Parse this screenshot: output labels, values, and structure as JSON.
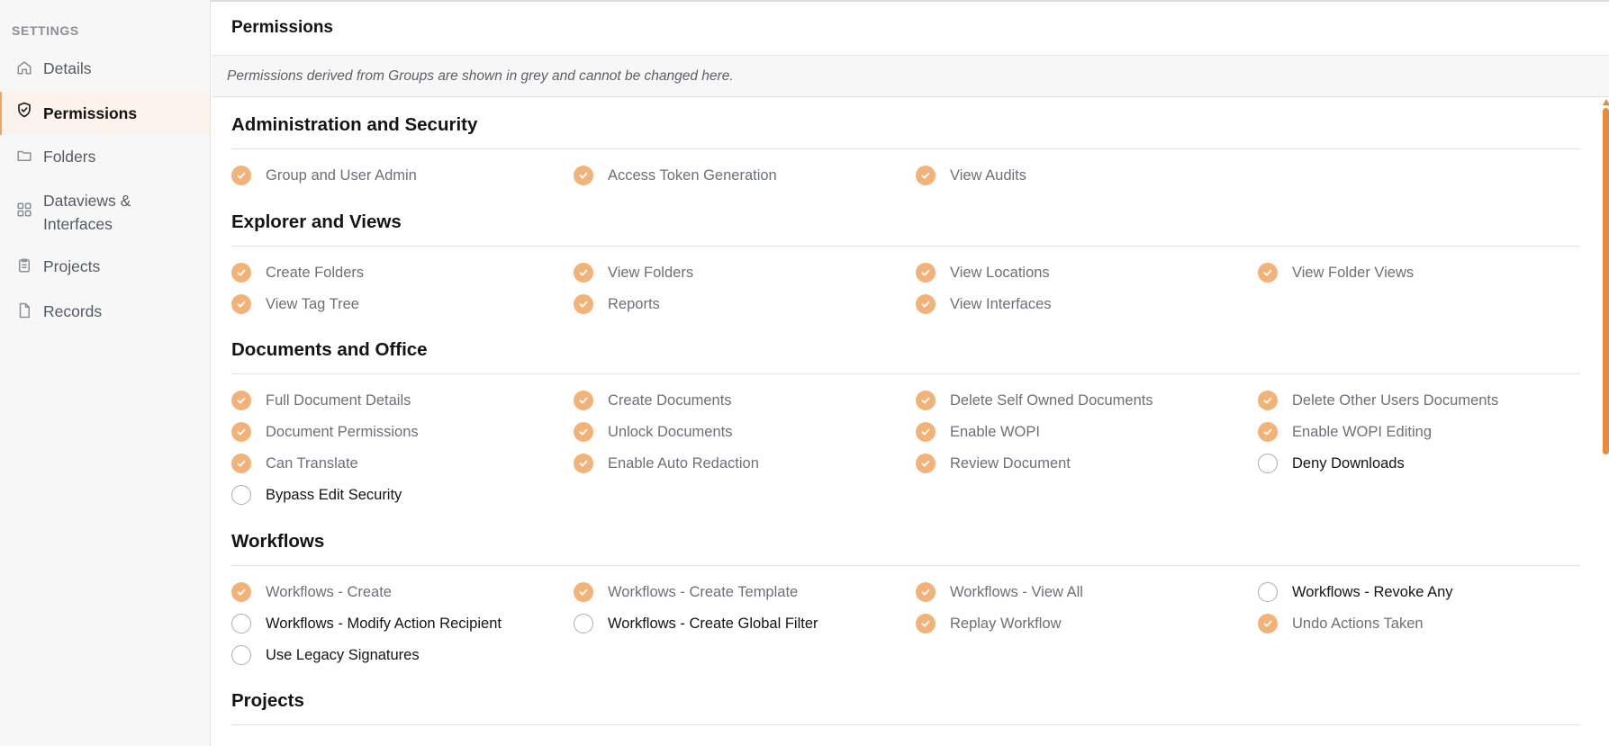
{
  "sidebar": {
    "heading": "SETTINGS",
    "items": [
      {
        "label": "Details",
        "icon": "home-icon"
      },
      {
        "label": "Permissions",
        "icon": "shield-check-icon",
        "active": true
      },
      {
        "label": "Folders",
        "icon": "folder-icon"
      },
      {
        "label": "Dataviews & Interfaces",
        "icon": "grid-icon"
      },
      {
        "label": "Projects",
        "icon": "clipboard-icon"
      },
      {
        "label": "Records",
        "icon": "document-icon"
      }
    ]
  },
  "header": {
    "title": "Permissions"
  },
  "notice": "Permissions derived from Groups are shown in grey and cannot be changed here.",
  "colors": {
    "accent": "#f2b37a",
    "scrollbar": "#e88a3a",
    "active_bg": "#fbf3ec"
  },
  "sections": [
    {
      "title": "Administration and Security",
      "permissions": [
        {
          "label": "Group and User Admin",
          "checked": true,
          "inherited": true
        },
        {
          "label": "Access Token Generation",
          "checked": true,
          "inherited": true
        },
        {
          "label": "View Audits",
          "checked": true,
          "inherited": true
        }
      ]
    },
    {
      "title": "Explorer and Views",
      "permissions": [
        {
          "label": "Create Folders",
          "checked": true,
          "inherited": true
        },
        {
          "label": "View Folders",
          "checked": true,
          "inherited": true
        },
        {
          "label": "View Locations",
          "checked": true,
          "inherited": true
        },
        {
          "label": "View Folder Views",
          "checked": true,
          "inherited": true
        },
        {
          "label": "View Tag Tree",
          "checked": true,
          "inherited": true
        },
        {
          "label": "Reports",
          "checked": true,
          "inherited": true
        },
        {
          "label": "View Interfaces",
          "checked": true,
          "inherited": true
        }
      ]
    },
    {
      "title": "Documents and Office",
      "permissions": [
        {
          "label": "Full Document Details",
          "checked": true,
          "inherited": true
        },
        {
          "label": "Create Documents",
          "checked": true,
          "inherited": true
        },
        {
          "label": "Delete Self Owned Documents",
          "checked": true,
          "inherited": true
        },
        {
          "label": "Delete Other Users Documents",
          "checked": true,
          "inherited": true
        },
        {
          "label": "Document Permissions",
          "checked": true,
          "inherited": true
        },
        {
          "label": "Unlock Documents",
          "checked": true,
          "inherited": true
        },
        {
          "label": "Enable WOPI",
          "checked": true,
          "inherited": true
        },
        {
          "label": "Enable WOPI Editing",
          "checked": true,
          "inherited": true
        },
        {
          "label": "Can Translate",
          "checked": true,
          "inherited": true
        },
        {
          "label": "Enable Auto Redaction",
          "checked": true,
          "inherited": true
        },
        {
          "label": "Review Document",
          "checked": true,
          "inherited": true
        },
        {
          "label": "Deny Downloads",
          "checked": false,
          "inherited": false
        },
        {
          "label": "Bypass Edit Security",
          "checked": false,
          "inherited": false
        }
      ]
    },
    {
      "title": "Workflows",
      "permissions": [
        {
          "label": "Workflows - Create",
          "checked": true,
          "inherited": true
        },
        {
          "label": "Workflows - Create Template",
          "checked": true,
          "inherited": true
        },
        {
          "label": "Workflows - View All",
          "checked": true,
          "inherited": true
        },
        {
          "label": "Workflows - Revoke Any",
          "checked": false,
          "inherited": false
        },
        {
          "label": "Workflows - Modify Action Recipient",
          "checked": false,
          "inherited": false
        },
        {
          "label": "Workflows - Create Global Filter",
          "checked": false,
          "inherited": false
        },
        {
          "label": "Replay Workflow",
          "checked": true,
          "inherited": true
        },
        {
          "label": "Undo Actions Taken",
          "checked": true,
          "inherited": true
        },
        {
          "label": "Use Legacy Signatures",
          "checked": false,
          "inherited": false
        }
      ]
    },
    {
      "title": "Projects",
      "permissions": []
    }
  ]
}
